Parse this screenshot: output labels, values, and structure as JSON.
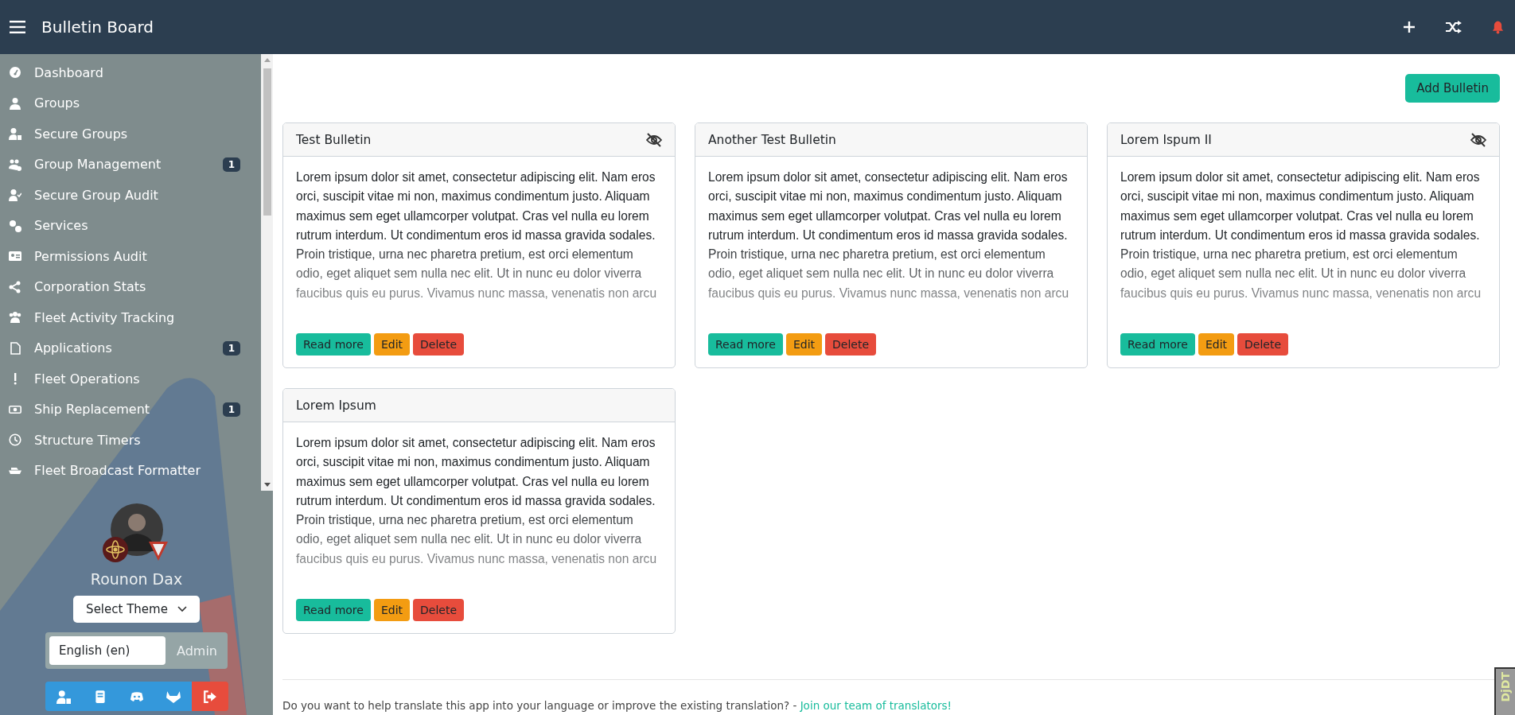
{
  "header": {
    "title": "Bulletin Board"
  },
  "sidebar": {
    "items": [
      {
        "label": "Dashboard"
      },
      {
        "label": "Groups"
      },
      {
        "label": "Secure Groups"
      },
      {
        "label": "Group Management",
        "badge": "1"
      },
      {
        "label": "Secure Group Audit"
      },
      {
        "label": "Services"
      },
      {
        "label": "Permissions Audit"
      },
      {
        "label": "Corporation Stats"
      },
      {
        "label": "Fleet Activity Tracking"
      },
      {
        "label": "Applications",
        "badge": "1"
      },
      {
        "label": "Fleet Operations"
      },
      {
        "label": "Ship Replacement",
        "badge": "1"
      },
      {
        "label": "Structure Timers"
      },
      {
        "label": "Fleet Broadcast Formatter"
      }
    ],
    "user": {
      "name": "Rounon Dax"
    },
    "theme_select": {
      "value": "Select Theme"
    },
    "language_select": {
      "value": "English (en)"
    },
    "admin_link": "Admin"
  },
  "add_button": "Add Bulletin",
  "bulletins": [
    {
      "title": "Test Bulletin",
      "hidden": true,
      "body": "Lorem ipsum dolor sit amet, consectetur adipiscing elit. Nam eros orci, suscipit vitae mi non, maximus condimentum justo. Aliquam maximus sem eget ullamcorper volutpat. Cras vel nulla eu lorem rutrum interdum. Ut condimentum eros id massa gravida sodales. Proin tristique, urna nec pharetra pretium, est orci elementum odio, eget aliquet sem nulla nec elit. Ut in nunc eu dolor viverra faucibus quis eu purus. Vivamus nunc massa, venenatis non arcu",
      "actions": [
        "Read more",
        "Edit",
        "Delete"
      ]
    },
    {
      "title": "Another Test Bulletin",
      "hidden": false,
      "body": "Lorem ipsum dolor sit amet, consectetur adipiscing elit. Nam eros orci, suscipit vitae mi non, maximus condimentum justo. Aliquam maximus sem eget ullamcorper volutpat. Cras vel nulla eu lorem rutrum interdum. Ut condimentum eros id massa gravida sodales. Proin tristique, urna nec pharetra pretium, est orci elementum odio, eget aliquet sem nulla nec elit. Ut in nunc eu dolor viverra faucibus quis eu purus. Vivamus nunc massa, venenatis non arcu",
      "actions": [
        "Read more",
        "Edit",
        "Delete"
      ]
    },
    {
      "title": "Lorem Ispum II",
      "hidden": true,
      "body": "Lorem ipsum dolor sit amet, consectetur adipiscing elit. Nam eros orci, suscipit vitae mi non, maximus condimentum justo. Aliquam maximus sem eget ullamcorper volutpat. Cras vel nulla eu lorem rutrum interdum. Ut condimentum eros id massa gravida sodales. Proin tristique, urna nec pharetra pretium, est orci elementum odio, eget aliquet sem nulla nec elit. Ut in nunc eu dolor viverra faucibus quis eu purus. Vivamus nunc massa, venenatis non arcu",
      "actions": [
        "Read more",
        "Edit",
        "Delete"
      ]
    },
    {
      "title": "Lorem Ipsum",
      "hidden": false,
      "body": "Lorem ipsum dolor sit amet, consectetur adipiscing elit. Nam eros orci, suscipit vitae mi non, maximus condimentum justo. Aliquam maximus sem eget ullamcorper volutpat. Cras vel nulla eu lorem rutrum interdum. Ut condimentum eros id massa gravida sodales. Proin tristique, urna nec pharetra pretium, est orci elementum odio, eget aliquet sem nulla nec elit. Ut in nunc eu dolor viverra faucibus quis eu purus. Vivamus nunc massa, venenatis non arcu",
      "actions": [
        "Read more",
        "Edit",
        "Delete"
      ]
    }
  ],
  "footer": {
    "text": "Do you want to help translate this app into your language or improve the existing translation? -",
    "link": "Join our team of translators!"
  },
  "debug_tab": "DjDT"
}
